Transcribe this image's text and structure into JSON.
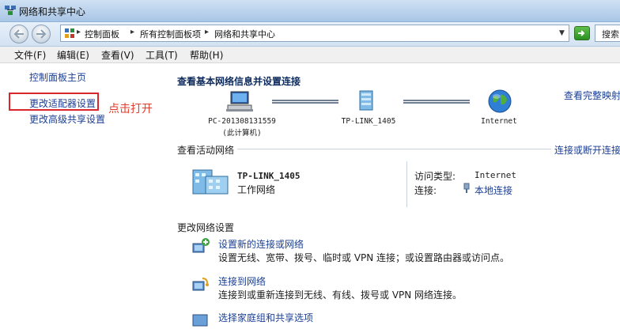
{
  "window": {
    "title": "网络和共享中心"
  },
  "address": {
    "crumbs": [
      "控制面板",
      "所有控制面板项",
      "网络和共享中心"
    ],
    "search_placeholder": "搜索"
  },
  "menu": [
    "文件(F)",
    "编辑(E)",
    "查看(V)",
    "工具(T)",
    "帮助(H)"
  ],
  "sidebar": {
    "items": [
      "控制面板主页",
      "更改适配器设置",
      "更改高级共享设置"
    ],
    "annotation": "点击打开"
  },
  "main": {
    "heading": "查看基本网络信息并设置连接",
    "full_map_link": "查看完整映射",
    "nodes": [
      {
        "label1": "PC-201308131559",
        "label2": "(此计算机)"
      },
      {
        "label1": "TP-LINK_1405",
        "label2": ""
      },
      {
        "label1": "Internet",
        "label2": ""
      }
    ],
    "active_section": "查看活动网络",
    "connect_link": "连接或断开连接",
    "active_network": {
      "name": "TP-LINK_1405",
      "type": "工作网络",
      "access_label": "访问类型:",
      "access_value": "Internet",
      "conn_label": "连接:",
      "conn_value": "本地连接"
    },
    "change_section": "更改网络设置",
    "tasks": [
      {
        "title": "设置新的连接或网络",
        "desc": "设置无线、宽带、拨号、临时或 VPN 连接；或设置路由器或访问点。"
      },
      {
        "title": "连接到网络",
        "desc": "连接到或重新连接到无线、有线、拨号或 VPN 网络连接。"
      },
      {
        "title": "选择家庭组和共享选项",
        "desc": ""
      }
    ]
  }
}
